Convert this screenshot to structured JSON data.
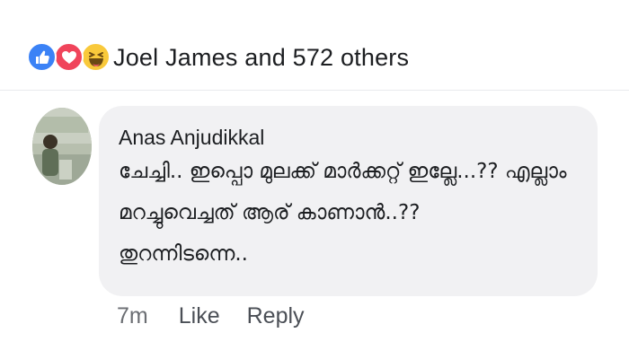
{
  "reactions": {
    "icons": [
      "like-icon",
      "love-icon",
      "haha-icon"
    ],
    "colors": {
      "like": "#3b82f6",
      "love": "#f0445b",
      "haha": "#f9c93b"
    },
    "summary": "Joel James and 572 others"
  },
  "comment": {
    "author": "Anas Anjudikkal",
    "lines": [
      "ചേച്ചി.. ഇപ്പൊ മുലക്ക് മാർക്കറ്റ് ഇല്ലേ...?? എല്ലാം",
      "മറച്ചുവെച്ചത് ആര് കാണാൻ..??",
      "തുറന്നിടന്നെ.."
    ],
    "time": "7m",
    "like_label": "Like",
    "reply_label": "Reply"
  }
}
